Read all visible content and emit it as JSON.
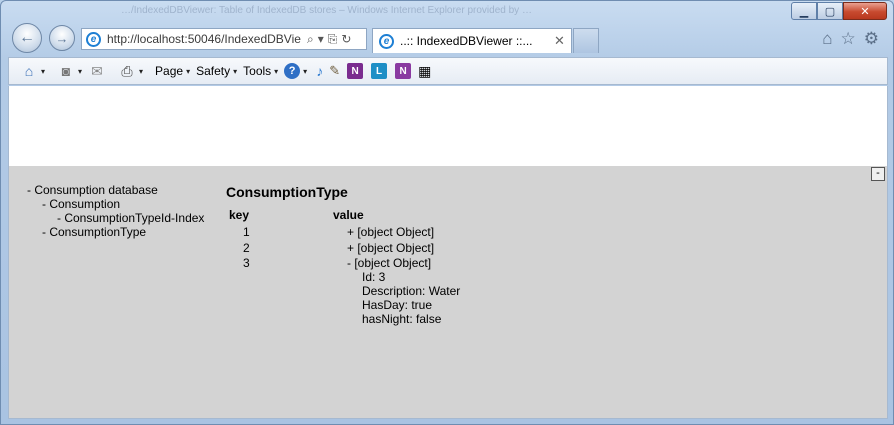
{
  "window": {
    "title_ghost": "…/IndexedDBViewer: Table of IndexedDB stores – Windows Internet Explorer provided by …",
    "minimize": "▁",
    "maximize": "▢",
    "close": "✕"
  },
  "address": {
    "url": "http://localhost:50046/IndexedDBVie",
    "search_icon": "⌕",
    "dropdown_icon": "▾",
    "compat_icon": "⎘",
    "refresh_icon": "↻"
  },
  "tab": {
    "title": "..:: IndexedDBViewer ::...",
    "close": "✕"
  },
  "right_icons": {
    "home": "⌂",
    "favorites": "☆",
    "settings": "⚙"
  },
  "command_bar": {
    "home_icon": "⌂",
    "feeds_icon": "◙",
    "mail_icon": "✉",
    "print_icon": "⎙",
    "page": "Page",
    "safety": "Safety",
    "tools": "Tools",
    "help_icon": "?",
    "caret": "▾",
    "addon_n1": "N",
    "addon_l": "L",
    "addon_n2": "N"
  },
  "viewer": {
    "collapse": "-",
    "tree": {
      "database": "- Consumption database",
      "store_consumption": "- Consumption",
      "index": "- ConsumptionTypeId-Index",
      "store_type": "- ConsumptionType"
    },
    "store_title": "ConsumptionType",
    "columns": {
      "key": "key",
      "value": "value"
    },
    "rows": [
      {
        "key": "1",
        "value": "+ [object Object]"
      },
      {
        "key": "2",
        "value": "+ [object Object]"
      },
      {
        "key": "3",
        "value": "- [object Object]"
      }
    ],
    "expanded": [
      "Id: 3",
      "Description: Water",
      "HasDay: true",
      "hasNight: false"
    ]
  }
}
